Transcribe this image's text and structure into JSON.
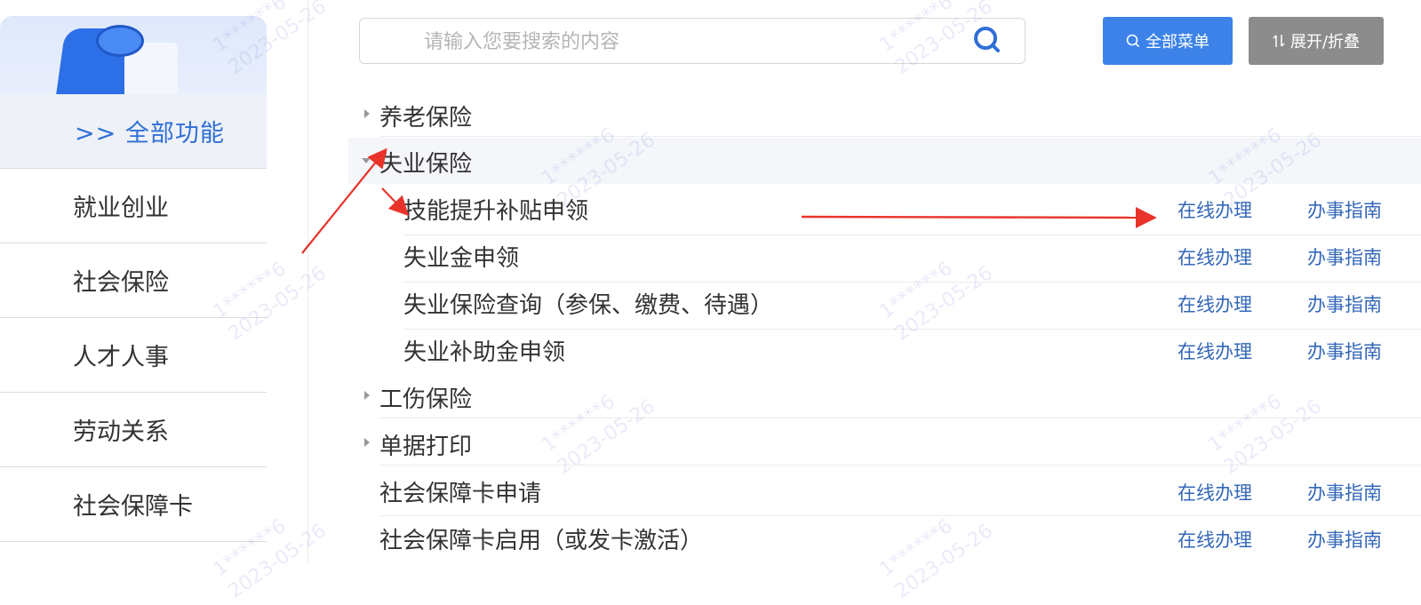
{
  "sidebar": {
    "all_label": ">> 全部功能",
    "items": [
      {
        "label": "就业创业"
      },
      {
        "label": "社会保险"
      },
      {
        "label": "人才人事"
      },
      {
        "label": "劳动关系"
      },
      {
        "label": "社会保障卡"
      }
    ]
  },
  "search": {
    "placeholder": "请输入您要搜索的内容",
    "value": ""
  },
  "toolbar": {
    "menu_label": "全部菜单",
    "toggle_label": "展开/折叠"
  },
  "list": {
    "categories": [
      {
        "label": "养老保险",
        "expanded": false
      },
      {
        "label": "失业保险",
        "expanded": true,
        "children": [
          {
            "label": "技能提升补贴申领",
            "online": "在线办理",
            "guide": "办事指南"
          },
          {
            "label": "失业金申领",
            "online": "在线办理",
            "guide": "办事指南"
          },
          {
            "label": "失业保险查询（参保、缴费、待遇）",
            "online": "在线办理",
            "guide": "办事指南"
          },
          {
            "label": "失业补助金申领",
            "online": "在线办理",
            "guide": "办事指南"
          }
        ]
      },
      {
        "label": "工伤保险",
        "expanded": false
      },
      {
        "label": "单据打印",
        "expanded": false
      }
    ],
    "items": [
      {
        "label": "社会保障卡申请",
        "online": "在线办理",
        "guide": "办事指南"
      },
      {
        "label": "社会保障卡启用（或发卡激活）",
        "online": "在线办理",
        "guide": "办事指南"
      }
    ]
  },
  "watermark": {
    "line1": "1******6",
    "line2": "2023-05-26"
  },
  "colors": {
    "accent": "#3c82e8",
    "toggle": "#8c8c8c",
    "link": "#3468b8",
    "sidebar_active": "#2f6fd6",
    "annotation_arrow": "#e8332a"
  }
}
